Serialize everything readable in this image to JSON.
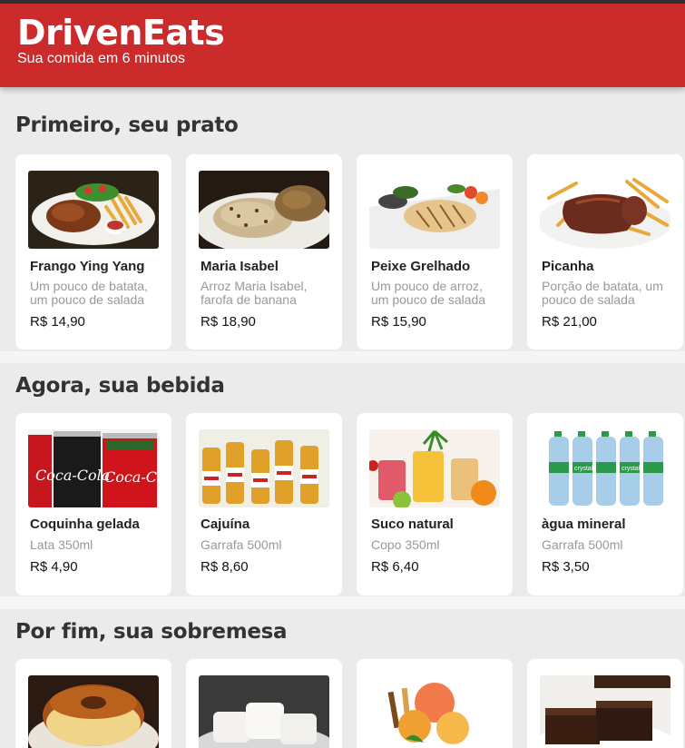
{
  "header": {
    "logo": "DrivenEats",
    "tagline": "Sua comida em 6 minutos"
  },
  "sections": [
    {
      "title": "Primeiro, seu prato",
      "items": [
        {
          "name": "Frango Ying Yang",
          "description": "Um pouco de batata, um pouco de salada",
          "price": "R$ 14,90",
          "image": "grilled-chicken-with-fries"
        },
        {
          "name": "Maria Isabel",
          "description": "Arroz Maria Isabel, farofa de banana",
          "price": "R$ 18,90",
          "image": "rice-dish"
        },
        {
          "name": "Peixe Grelhado",
          "description": "Um pouco de arroz, um pouco de salada",
          "price": "R$ 15,90",
          "image": "grilled-fish-with-vegetables"
        },
        {
          "name": "Picanha",
          "description": "Porção de batata, um pouco de salada",
          "price": "R$ 21,00",
          "image": "steak-with-fries"
        }
      ]
    },
    {
      "title": "Agora, sua bebida",
      "items": [
        {
          "name": "Coquinha gelada",
          "description": "Lata 350ml",
          "price": "R$ 4,90",
          "image": "cola-cans"
        },
        {
          "name": "Cajuína",
          "description": "Garrafa 500ml",
          "price": "R$ 8,60",
          "image": "cajuina-bottles"
        },
        {
          "name": "Suco natural",
          "description": "Copo 350ml",
          "price": "R$ 6,40",
          "image": "juice-glasses"
        },
        {
          "name": "àgua mineral",
          "description": "Garrafa 500ml",
          "price": "R$ 3,50",
          "image": "water-bottles"
        }
      ]
    },
    {
      "title": "Por fim, sua sobremesa",
      "items": [
        {
          "image": "flan"
        },
        {
          "image": "coconut-cake"
        },
        {
          "image": "ice-cream-cup"
        },
        {
          "image": "brownies"
        }
      ]
    }
  ],
  "image_labels": {
    "cola_text": "Coca-Cola",
    "water_brand": "crystal"
  },
  "colors": {
    "header_bg": "#cb2b2b",
    "page_bg": "#ebebeb",
    "card_bg": "#ffffff",
    "title_text": "#333333",
    "description_text": "#999999"
  }
}
